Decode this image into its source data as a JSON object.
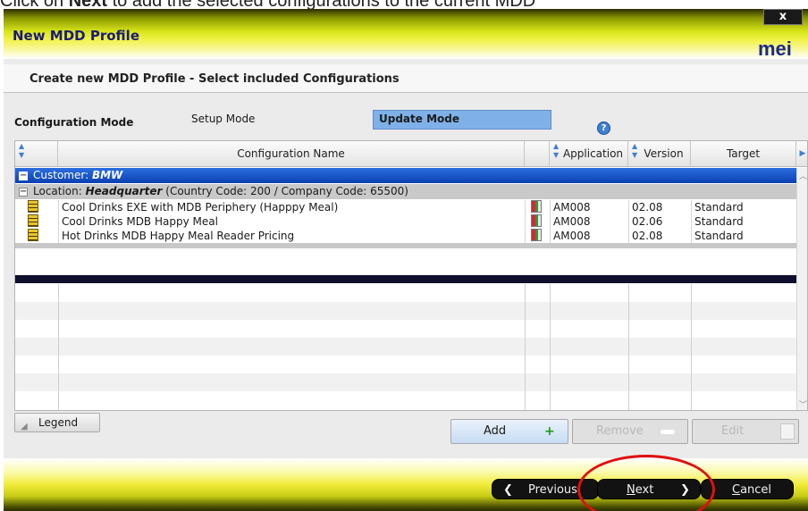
{
  "caption": {
    "before": "Click on ",
    "bold": "Next",
    "after": " to add the selected configurations to the current MDD"
  },
  "window": {
    "title": "New MDD Profile",
    "close": "x",
    "logo": "mei"
  },
  "subheader": "Create new MDD Profile - Select included Configurations",
  "mode": {
    "label": "Configuration Mode",
    "setup": "Setup Mode",
    "update": "Update Mode",
    "help": "?"
  },
  "columns": {
    "name": "Configuration Name",
    "application": "Application",
    "version": "Version",
    "target": "Target"
  },
  "group": {
    "customer_label": "Customer:",
    "customer_value": "BMW",
    "location_label": "Location:",
    "location_value": "Headquarter",
    "location_detail": "(Country Code: 200 / Company Code: 65500)"
  },
  "rows": [
    {
      "name": "Cool Drinks EXE with MDB Periphery (Happpy Meal)",
      "application": "AM008",
      "version": "02.08",
      "target": "Standard"
    },
    {
      "name": "Cool Drinks MDB Happy Meal",
      "application": "AM008",
      "version": "02.06",
      "target": "Standard"
    },
    {
      "name": "Hot Drinks MDB Happy Meal Reader Pricing",
      "application": "AM008",
      "version": "02.08",
      "target": "Standard"
    }
  ],
  "buttons": {
    "legend": "Legend",
    "add": "Add",
    "remove": "Remove",
    "edit": "Edit"
  },
  "nav": {
    "previous": "Previous",
    "next_first": "N",
    "next_rest": "ext",
    "cancel_first": "C",
    "cancel_rest": "ancel"
  },
  "colors": {
    "accent_blue": "#0c3fb0",
    "highlight": "#7fb1e8",
    "annotation": "#e01010",
    "title_text": "#1a1a7a"
  }
}
